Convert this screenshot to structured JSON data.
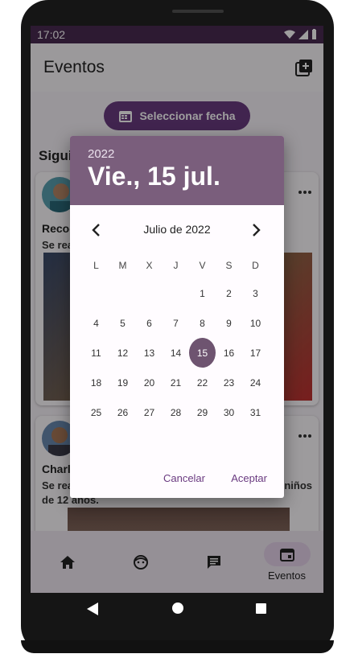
{
  "status_bar": {
    "time": "17:02"
  },
  "app_bar": {
    "title": "Eventos",
    "add_icon": "add-box-icon"
  },
  "select_date_button": {
    "label": "Seleccionar fecha",
    "icon": "calendar-icon"
  },
  "section_label": "Sigui",
  "cards": [
    {
      "title": "Recog",
      "text": "Se real",
      "more_icon": "more-horizontal-icon"
    },
    {
      "title": "Charla",
      "text": "Se real",
      "text_right": "s niños",
      "text_line2": "de 12 años.",
      "more_icon": "more-horizontal-icon"
    }
  ],
  "bottom_nav": {
    "items": [
      {
        "icon": "home-icon",
        "label": ""
      },
      {
        "icon": "face-icon",
        "label": ""
      },
      {
        "icon": "chat-icon",
        "label": ""
      },
      {
        "icon": "event-icon",
        "label": "Eventos",
        "active": true
      }
    ]
  },
  "date_picker": {
    "year": "2022",
    "selected_label": "Vie., 15 jul.",
    "month_label": "Julio de 2022",
    "weekdays": [
      "L",
      "M",
      "X",
      "J",
      "V",
      "S",
      "D"
    ],
    "weeks": [
      [
        "",
        "",
        "",
        "",
        "1",
        "2",
        "3"
      ],
      [
        "4",
        "5",
        "6",
        "7",
        "8",
        "9",
        "10"
      ],
      [
        "11",
        "12",
        "13",
        "14",
        "15",
        "16",
        "17"
      ],
      [
        "18",
        "19",
        "20",
        "21",
        "22",
        "23",
        "24"
      ],
      [
        "25",
        "26",
        "27",
        "28",
        "29",
        "30",
        "31"
      ]
    ],
    "selected_day": "15",
    "cancel_label": "Cancelar",
    "accept_label": "Aceptar"
  },
  "colors": {
    "primary": "#6a3a80",
    "dialog_header": "#7a5e7c",
    "status_bar": "#4a2a52"
  }
}
